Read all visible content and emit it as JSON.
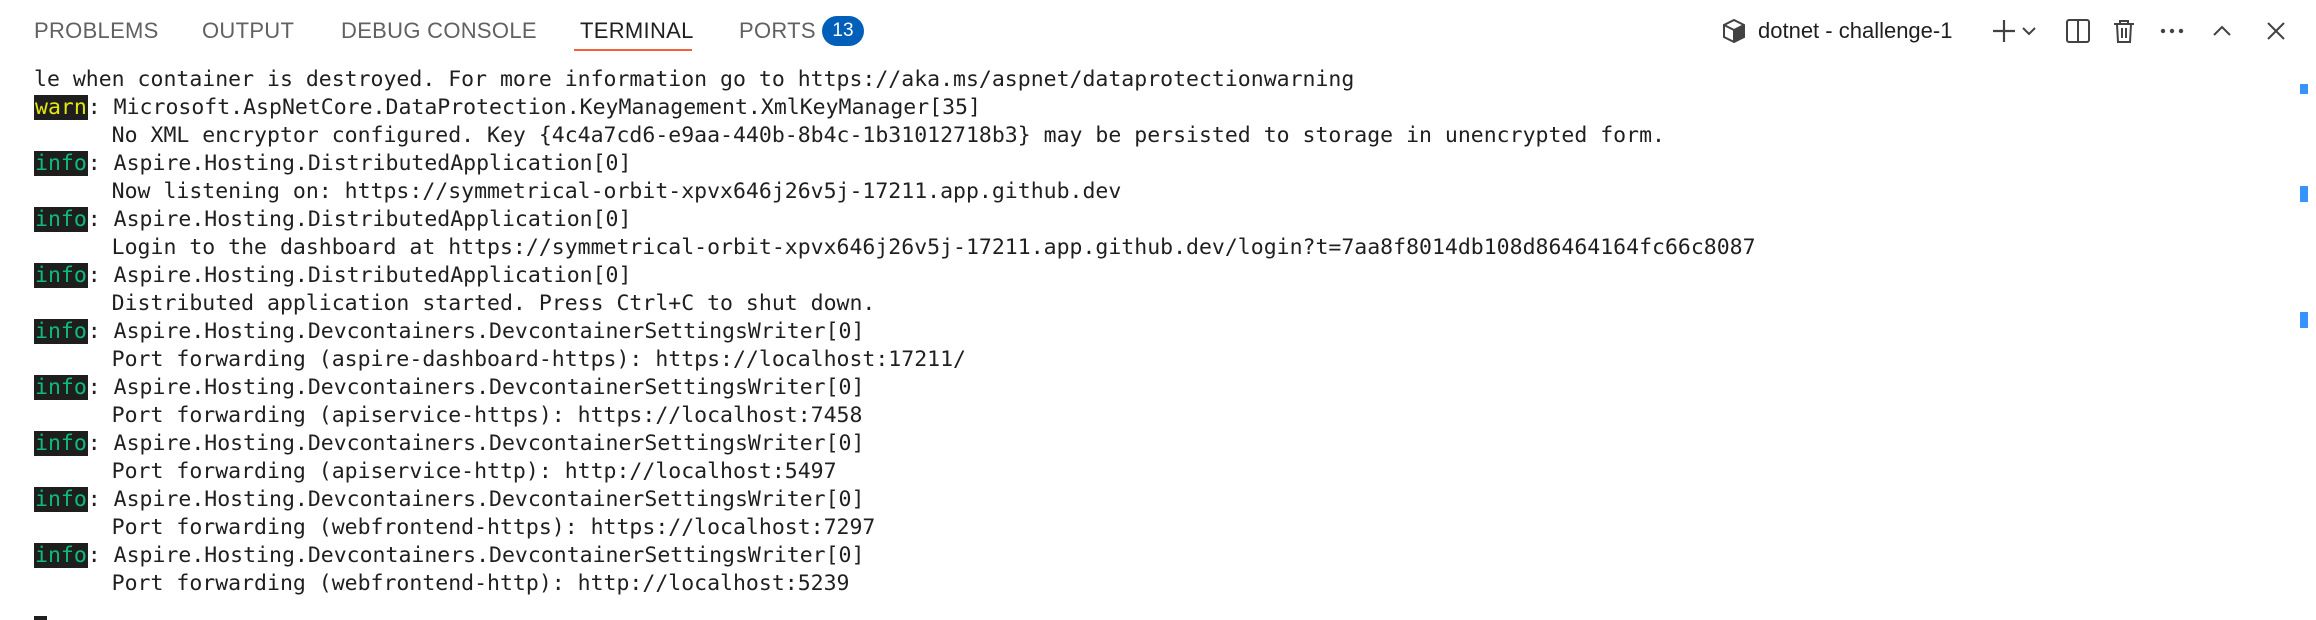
{
  "panel": {
    "tabs": [
      {
        "label": "PROBLEMS"
      },
      {
        "label": "OUTPUT"
      },
      {
        "label": "DEBUG CONSOLE"
      },
      {
        "label": "TERMINAL"
      },
      {
        "label": "PORTS"
      }
    ],
    "active_tab": "TERMINAL",
    "ports_badge": "13",
    "terminal_name": "dotnet - challenge-1",
    "accent_color": "#f2613f",
    "badge_color": "#005fb8",
    "icons": [
      "terminal-icon",
      "plus-icon",
      "chevron-down-icon",
      "split-icon",
      "trash-icon",
      "ellipsis-icon",
      "chevron-up-icon",
      "close-icon"
    ]
  },
  "terminal": {
    "lines": [
      {
        "level": "",
        "text": "le when container is destroyed. For more information go to https://aka.ms/aspnet/dataprotectionwarning"
      },
      {
        "level": "warn",
        "text": ": Microsoft.AspNetCore.DataProtection.KeyManagement.XmlKeyManager[35]"
      },
      {
        "level": "",
        "text": "      No XML encryptor configured. Key {4c4a7cd6-e9aa-440b-8b4c-1b31012718b3} may be persisted to storage in unencrypted form."
      },
      {
        "level": "info",
        "text": ": Aspire.Hosting.DistributedApplication[0]"
      },
      {
        "level": "",
        "text": "      Now listening on: https://symmetrical-orbit-xpvx646j26v5j-17211.app.github.dev"
      },
      {
        "level": "info",
        "text": ": Aspire.Hosting.DistributedApplication[0]"
      },
      {
        "level": "",
        "text": "      Login to the dashboard at https://symmetrical-orbit-xpvx646j26v5j-17211.app.github.dev/login?t=7aa8f8014db108d86464164fc66c8087"
      },
      {
        "level": "info",
        "text": ": Aspire.Hosting.DistributedApplication[0]"
      },
      {
        "level": "",
        "text": "      Distributed application started. Press Ctrl+C to shut down."
      },
      {
        "level": "info",
        "text": ": Aspire.Hosting.Devcontainers.DevcontainerSettingsWriter[0]"
      },
      {
        "level": "",
        "text": "      Port forwarding (aspire-dashboard-https): https://localhost:17211/"
      },
      {
        "level": "info",
        "text": ": Aspire.Hosting.Devcontainers.DevcontainerSettingsWriter[0]"
      },
      {
        "level": "",
        "text": "      Port forwarding (apiservice-https): https://localhost:7458"
      },
      {
        "level": "info",
        "text": ": Aspire.Hosting.Devcontainers.DevcontainerSettingsWriter[0]"
      },
      {
        "level": "",
        "text": "      Port forwarding (apiservice-http): http://localhost:5497"
      },
      {
        "level": "info",
        "text": ": Aspire.Hosting.Devcontainers.DevcontainerSettingsWriter[0]"
      },
      {
        "level": "",
        "text": "      Port forwarding (webfrontend-https): https://localhost:7297"
      },
      {
        "level": "info",
        "text": ": Aspire.Hosting.Devcontainers.DevcontainerSettingsWriter[0]"
      },
      {
        "level": "",
        "text": "      Port forwarding (webfrontend-http): http://localhost:5239"
      }
    ],
    "level_colors": {
      "info": "#0dbc79",
      "warn": "#e5e510",
      "badge_bg": "#1e1e1e"
    }
  }
}
